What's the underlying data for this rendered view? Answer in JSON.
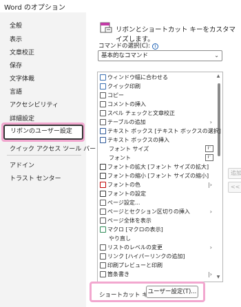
{
  "window_title": "Word のオプション",
  "sidebar": {
    "items": [
      {
        "label": "全般"
      },
      {
        "label": "表示"
      },
      {
        "label": "文章校正"
      },
      {
        "label": "保存"
      },
      {
        "label": "文字体裁"
      },
      {
        "label": "言語"
      },
      {
        "label": "アクセシビリティ"
      },
      {
        "label": "詳細設定"
      },
      {
        "label": "リボンのユーザー設定"
      },
      {
        "label": "クイック アクセス ツール バー"
      },
      {
        "label": "アドイン"
      },
      {
        "label": "トラスト センター"
      }
    ],
    "selected_index": 8
  },
  "main": {
    "heading": "リボンとショートカット キーをカスタマイズします。",
    "command_select_label": "コマンドの選択(C):",
    "info_icon": "i",
    "dropdown_value": "基本的なコマンド",
    "commands": [
      {
        "label": "ウィンドウ幅に合わせる",
        "icon": "page-icon"
      },
      {
        "label": "クイック印刷",
        "icon": "print-icon"
      },
      {
        "label": "コピー",
        "icon": "copy-icon"
      },
      {
        "label": "コメントの挿入",
        "icon": "comment-icon"
      },
      {
        "label": "スペル チェックと文章校正",
        "icon": "spellcheck-icon"
      },
      {
        "label": "テーブルの追加",
        "icon": "table-icon",
        "submenu": "›"
      },
      {
        "label": "テキスト ボックス [テキスト ボックスの選択]",
        "icon": "textbox-icon",
        "submenu": "›"
      },
      {
        "label": "テキスト ボックスの挿入",
        "icon": "textbox-icon"
      },
      {
        "label": "フォント サイズ",
        "icon": "",
        "box": "I⁻"
      },
      {
        "label": "フォント",
        "icon": "",
        "box": "I⁻"
      },
      {
        "label": "フォントの拡大 [フォント サイズの拡大]",
        "icon": "font-grow-icon"
      },
      {
        "label": "フォントの縮小 [フォント サイズの縮小]",
        "icon": "font-shrink-icon"
      },
      {
        "label": "フォントの色",
        "icon": "font-color-icon",
        "submenu": "|›"
      },
      {
        "label": "フォントの設定",
        "icon": "font-settings-icon"
      },
      {
        "label": "ページ設定...",
        "icon": "page-setup-icon"
      },
      {
        "label": "ページとセクション区切りの挿入",
        "icon": "page-break-icon",
        "submenu": "›"
      },
      {
        "label": "ページ全体を表示",
        "icon": "whole-page-icon"
      },
      {
        "label": "マクロ [マクロの表示]",
        "icon": "macro-icon"
      },
      {
        "label": "やり直し",
        "icon": ""
      },
      {
        "label": "リストのレベルの変更",
        "icon": "list-level-icon",
        "submenu": "›"
      },
      {
        "label": "リンク [ハイパーリンクの追加]",
        "icon": "link-icon"
      },
      {
        "label": "印刷プレビューと印刷",
        "icon": "print-preview-icon"
      },
      {
        "label": "箇条書き",
        "icon": "bullets-icon",
        "submenu": "|›"
      }
    ],
    "add_button": "追加",
    "remove_button": "<<",
    "shortcut_label": "ショートカット キー:",
    "customize_button": "ユーザー設定(T)..."
  },
  "colors": {
    "highlight": "#f2a7cf",
    "accent": "#1a5fb4",
    "sidebar_bg": "#f3f3f3"
  }
}
